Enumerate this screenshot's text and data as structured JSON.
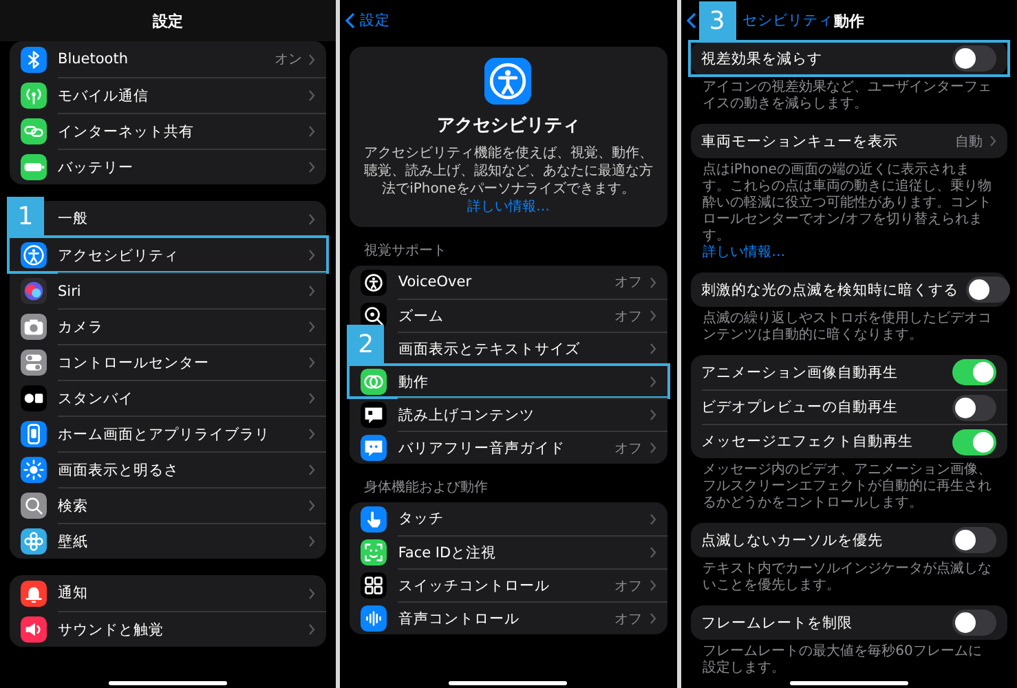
{
  "screens": [
    {
      "title": "設定",
      "sections": [
        {
          "kind": "group",
          "rows": [
            {
              "label": "Bluetooth",
              "kind": "link",
              "value": "オン",
              "color": "#0a84ff"
            },
            {
              "label": "モバイル通信",
              "kind": "link",
              "color": "#30d158"
            },
            {
              "label": "インターネット共有",
              "kind": "link",
              "color": "#30d158"
            },
            {
              "label": "バッテリー",
              "kind": "link",
              "color": "#30d158"
            }
          ]
        },
        {
          "kind": "group",
          "rows": [
            {
              "label": "一般",
              "kind": "link"
            },
            {
              "label": "アクセシビリティ",
              "kind": "link",
              "color": "#0a84ff",
              "step": "1"
            },
            {
              "label": "Siri",
              "kind": "link",
              "color": "#2c2c2e"
            },
            {
              "label": "カメラ",
              "kind": "link",
              "color": "#8e8e93"
            },
            {
              "label": "コントロールセンター",
              "kind": "link",
              "color": "#8e8e93"
            },
            {
              "label": "スタンバイ",
              "kind": "link",
              "color": "#000000"
            },
            {
              "label": "ホーム画面とアプリライブラリ",
              "kind": "link",
              "color": "#0a84ff"
            },
            {
              "label": "画面表示と明るさ",
              "kind": "link",
              "color": "#0a84ff"
            },
            {
              "label": "検索",
              "kind": "link",
              "color": "#8e8e93"
            },
            {
              "label": "壁紙",
              "kind": "link",
              "color": "#32ade6"
            }
          ]
        },
        {
          "kind": "group",
          "rows": [
            {
              "label": "通知",
              "kind": "link",
              "color": "#ff3b30"
            },
            {
              "label": "サウンドと触覚",
              "kind": "link",
              "color": "#ff2d55"
            }
          ]
        }
      ]
    },
    {
      "back": "設定",
      "sections": [
        {
          "kind": "hero",
          "title": "アクセシビリティ",
          "description": "アクセシビリティ機能を使えば、視覚、動作、聴覚、読み上げ、認知など、あなたに最適な方法でiPhoneをパーソナライズできます。",
          "link": "詳しい情報…"
        },
        {
          "kind": "group",
          "header": "視覚サポート",
          "rows": [
            {
              "label": "VoiceOver",
              "kind": "link",
              "value": "オフ",
              "color": "#000000"
            },
            {
              "label": "ズーム",
              "kind": "link",
              "value": "オフ",
              "color": "#000000"
            },
            {
              "label": "画面表示とテキストサイズ",
              "kind": "link"
            },
            {
              "label": "動作",
              "kind": "link",
              "color": "#30d158",
              "step": "2"
            },
            {
              "label": "読み上げコンテンツ",
              "kind": "link",
              "color": "#000000"
            },
            {
              "label": "バリアフリー音声ガイド",
              "kind": "link",
              "value": "オフ",
              "color": "#0a84ff"
            }
          ]
        },
        {
          "kind": "group",
          "header": "身体機能および動作",
          "rows": [
            {
              "label": "タッチ",
              "kind": "link",
              "color": "#0a84ff"
            },
            {
              "label": "Face IDと注視",
              "kind": "link",
              "color": "#30d158"
            },
            {
              "label": "スイッチコントロール",
              "kind": "link",
              "value": "オフ",
              "color": "#000000"
            },
            {
              "label": "音声コントロール",
              "kind": "link",
              "value": "オフ",
              "color": "#0a84ff"
            }
          ]
        }
      ]
    },
    {
      "back": "セシビリティ",
      "title": "動作",
      "sections": [
        {
          "kind": "group",
          "rows": [
            {
              "label": "視差効果を減らす",
              "kind": "toggle",
              "on": false,
              "step": "3"
            }
          ],
          "footer": "アイコンの視差効果など、ユーザインターフェイスの動きを減らします。"
        },
        {
          "kind": "group",
          "rows": [
            {
              "label": "車両モーションキューを表示",
              "kind": "link",
              "value": "自動"
            }
          ],
          "footer": "点はiPhoneの画面の端の近くに表示されます。これらの点は車両の動きに追従し、乗り物酔いの軽減に役立つ可能性があります。コントロールセンターでオン/オフを切り替えられます。",
          "link": "詳しい情報…"
        },
        {
          "kind": "group",
          "rows": [
            {
              "label": "刺激的な光の点滅を検知時に暗くする",
              "kind": "toggle",
              "on": false
            }
          ],
          "footer": "点滅の繰り返しやストロボを使用したビデオコンテンツは自動的に暗くなります。"
        },
        {
          "kind": "group",
          "rows": [
            {
              "label": "アニメーション画像自動再生",
              "kind": "toggle",
              "on": true
            },
            {
              "label": "ビデオプレビューの自動再生",
              "kind": "toggle",
              "on": false
            },
            {
              "label": "メッセージエフェクト自動再生",
              "kind": "toggle",
              "on": true
            }
          ],
          "footer": "メッセージ内のビデオ、アニメーション画像、フルスクリーンエフェクトが自動的に再生されるかどうかをコントロールします。"
        },
        {
          "kind": "group",
          "rows": [
            {
              "label": "点滅しないカーソルを優先",
              "kind": "toggle",
              "on": false
            }
          ],
          "footer": "テキスト内でカーソルインジケータが点滅しないことを優先します。"
        },
        {
          "kind": "group",
          "rows": [
            {
              "label": "フレームレートを制限",
              "kind": "toggle",
              "on": false
            }
          ],
          "footer": "フレームレートの最大値を毎秒60フレームに設定します。"
        }
      ]
    }
  ]
}
